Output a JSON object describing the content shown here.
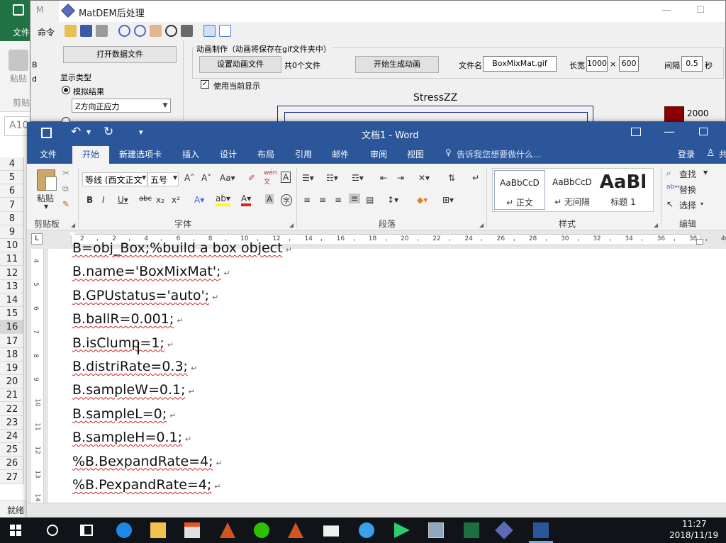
{
  "excel": {
    "tab_file": "文件",
    "paste_label": "粘贴",
    "clipboard_label": "剪贴",
    "namebox": "A10",
    "rows": [
      "4",
      "5",
      "6",
      "7",
      "8",
      "9",
      "10",
      "11",
      "12",
      "13",
      "14",
      "15",
      "16",
      "17",
      "18",
      "19",
      "20",
      "21",
      "22",
      "23",
      "24",
      "25",
      "26",
      "27"
    ],
    "selected_row": "16",
    "status": "就绪"
  },
  "matdem": {
    "title_back": "M",
    "title": "MatDEM后处理",
    "toolbar_cmd": "命令",
    "cell_b": "B",
    "cell_d": "d",
    "open_btn": "打开数据文件",
    "disp_type_label": "显示类型",
    "radio_sim": "模拟结果",
    "select_value": "Z方向正应力",
    "anim_title": "动画制作（动画将保存在gif文件夹中）",
    "set_anim_btn": "设置动画文件",
    "file_count": "共0个文件",
    "start_anim_btn": "开始生成动画",
    "filename_label": "文件名",
    "filename_value": "BoxMixMat",
    "filename_ext": ".gif",
    "size_label": "长宽",
    "width_value": "1000",
    "times": "×",
    "height_value": "600",
    "interval_label": "间隔",
    "interval_value": "0.5",
    "interval_unit": "秒",
    "use_current": "使用当前显示",
    "plot_title": "StressZZ",
    "colorbar_max": "2000",
    "colors": {
      "colorbar": "#8b0000",
      "frame": "#1a2a8a"
    }
  },
  "word": {
    "title": "文档1 - Word",
    "tabs": [
      "文件",
      "开始",
      "新建选项卡",
      "插入",
      "设计",
      "布局",
      "引用",
      "邮件",
      "审阅",
      "视图"
    ],
    "active_tab": "开始",
    "tell_me": "告诉我您想要做什么...",
    "signin": "登录",
    "share_cut": "共",
    "ribbon": {
      "paste": "粘贴",
      "clipboard": "剪贴板",
      "font_name": "等线 (西文正文",
      "font_size": "五号",
      "font_group": "字体",
      "paragraph_group": "段落",
      "styles_group": "样式",
      "editing_group": "编辑",
      "find": "查找",
      "replace": "替换",
      "select": "选择",
      "styles": [
        {
          "preview": "AaBbCcD",
          "name": "↵ 正文"
        },
        {
          "preview": "AaBbCcD",
          "name": "↵ 无间隔"
        },
        {
          "preview": "AaBl",
          "name": "标题 1"
        }
      ]
    },
    "ruler_top": [
      "2",
      "2",
      "4",
      "6",
      "8",
      "10",
      "12",
      "14",
      "16",
      "18",
      "20",
      "22",
      "24",
      "26",
      "28",
      "30",
      "32",
      "34",
      "36",
      "38",
      "40"
    ],
    "ruler_left": [
      "4",
      "5",
      "6",
      "7",
      "8",
      "9",
      "10",
      "11",
      "12",
      "13",
      "14"
    ],
    "lines": [
      "B=obj_Box;%build a box object",
      "B.name='BoxMixMat';",
      "B.GPUstatus='auto';",
      "B.ballR=0.001;",
      "B.isClump=1;",
      "B.distriRate=0.3;",
      "B.sampleW=0.1;",
      "B.sampleL=0;",
      "B.sampleH=0.1;",
      "%B.BexpandRate=4;",
      "%B.PexpandRate=4;"
    ],
    "pilcrow": "↵",
    "colors": {
      "titlebar": "#2b579a",
      "squiggle": "#d02020"
    }
  },
  "taskbar": {
    "time": "11:27",
    "date": "2018/11/19"
  }
}
